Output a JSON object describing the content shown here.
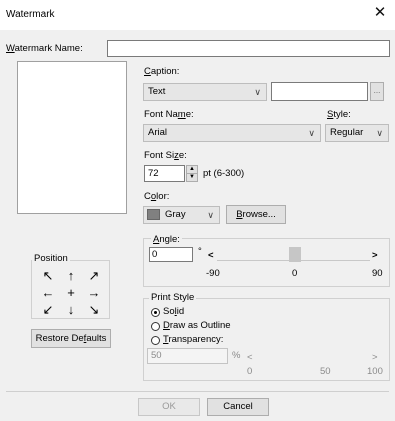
{
  "dialog": {
    "title": "Watermark",
    "close_glyph": "✕"
  },
  "watermark_name": {
    "label_first": "W",
    "label_rest": "atermark Name:",
    "value": ""
  },
  "caption": {
    "label_first": "C",
    "label_rest": "aption:",
    "type_value": "Text",
    "text_value": "",
    "ellipsis": "..."
  },
  "font_name": {
    "label_pre": "Font Na",
    "label_u": "m",
    "label_post": "e:",
    "value": "Arial"
  },
  "style": {
    "label_first": "S",
    "label_rest": "tyle:",
    "value": "Regular"
  },
  "font_size": {
    "label_pre": "Font Si",
    "label_u": "z",
    "label_post": "e:",
    "value": "72",
    "unit": "pt (6-300)"
  },
  "color": {
    "label_pre": "C",
    "label_u": "o",
    "label_post": "lor:",
    "value": "Gray",
    "swatch": "#808080",
    "browse_first": "B",
    "browse_rest": "rowse..."
  },
  "angle": {
    "label_first": "A",
    "label_rest": "ngle:",
    "value": "0",
    "degree": "°",
    "min": "-90",
    "mid": "0",
    "max": "90",
    "left_arrow": "<",
    "right_arrow": ">"
  },
  "position": {
    "label": "Position",
    "arrows": [
      "↖",
      "↑",
      "↗",
      "←",
      "+",
      "→",
      "↙",
      "↓",
      "↘"
    ]
  },
  "restore_defaults": {
    "label_pre": "Restore De",
    "label_u": "f",
    "label_post": "aults"
  },
  "print_style": {
    "label": "Print Style",
    "solid_pre": "So",
    "solid_u": "l",
    "solid_post": "id",
    "outline_first": "D",
    "outline_rest": "raw as Outline",
    "transparency_first": "T",
    "transparency_rest": "ransparency:",
    "transparency_value": "50",
    "percent": "%",
    "min": "0",
    "mid": "50",
    "max": "100",
    "left_arrow": "<",
    "right_arrow": ">"
  },
  "footer": {
    "ok": "OK",
    "cancel": "Cancel"
  }
}
